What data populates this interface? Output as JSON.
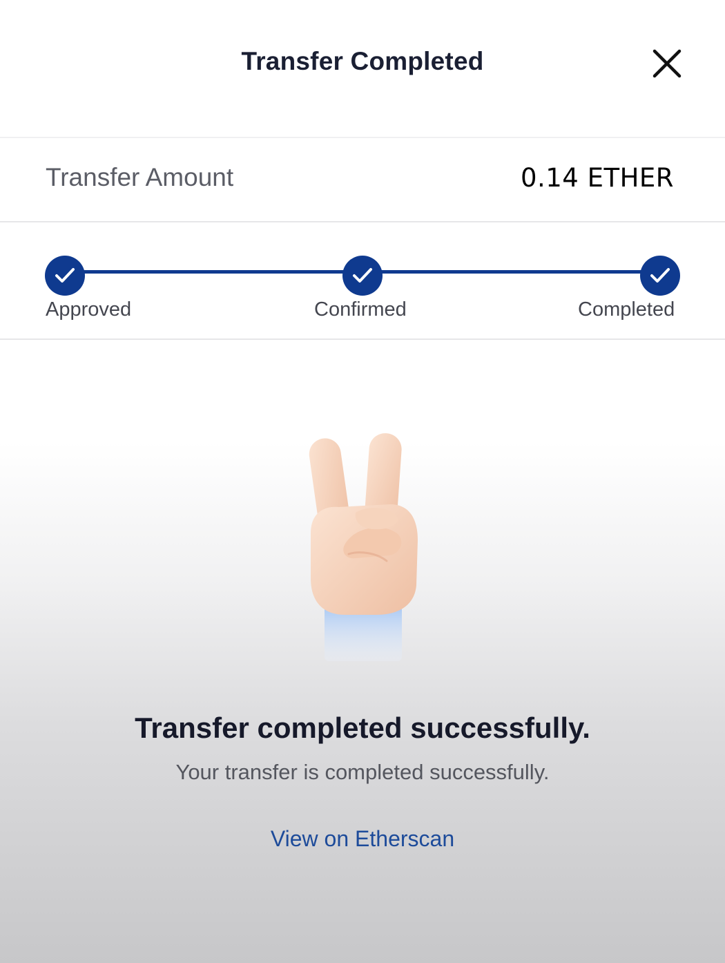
{
  "header": {
    "title": "Transfer Completed",
    "close_icon": "close-icon"
  },
  "transfer": {
    "amount_label": "Transfer Amount",
    "amount_value": "0.14 ETHER"
  },
  "progress": {
    "color": "#0f3a8f",
    "steps": [
      {
        "label": "Approved",
        "done": true,
        "icon": "check-icon"
      },
      {
        "label": "Confirmed",
        "done": true,
        "icon": "check-icon"
      },
      {
        "label": "Completed",
        "done": true,
        "icon": "check-icon"
      }
    ]
  },
  "hero": {
    "icon": "victory-hand-icon"
  },
  "message": {
    "title": "Transfer completed successfully.",
    "subtitle": "Your transfer is completed successfully."
  },
  "link": {
    "label": "View on Etherscan",
    "color": "#1d4b9a"
  }
}
